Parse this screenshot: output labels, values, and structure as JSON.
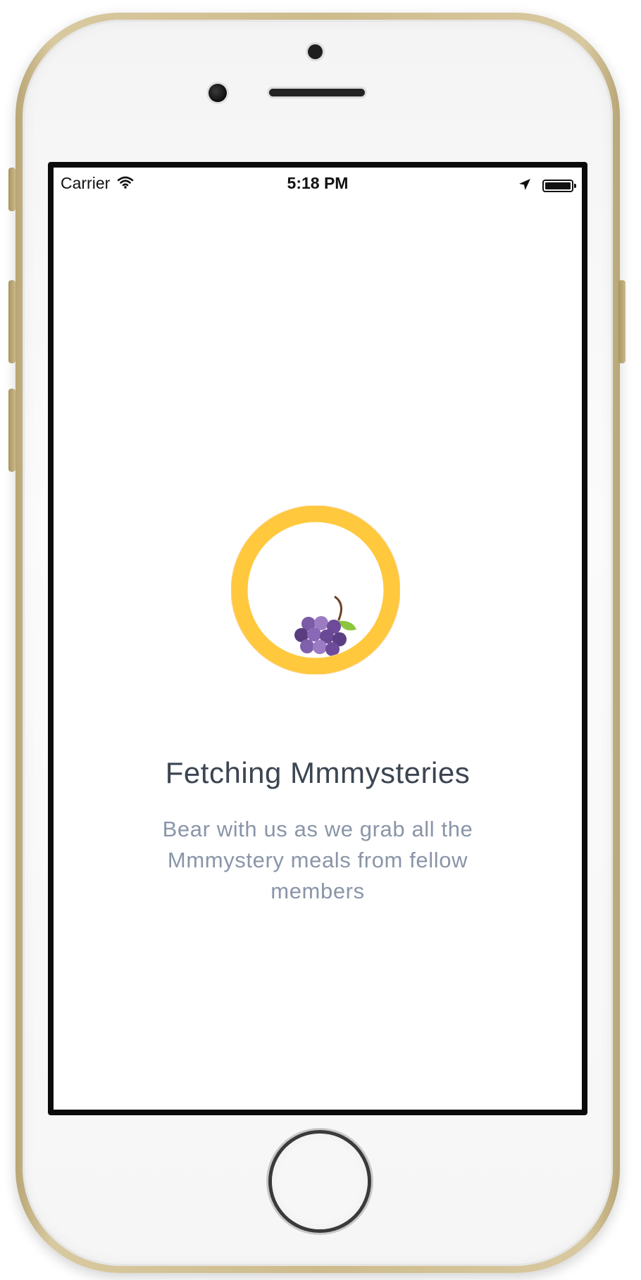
{
  "status_bar": {
    "carrier": "Carrier",
    "time": "5:18 PM",
    "battery_level": 1.0
  },
  "loading": {
    "title": "Fetching Mmmysteries",
    "message": "Bear with us as we grab all the Mmmystery meals from fellow members",
    "ring_color": "#ffc83d",
    "grape_color": "#7b5aa6",
    "leaf_color": "#8cc63f"
  },
  "icons": {
    "wifi": "wifi-icon",
    "location": "location-arrow-icon",
    "battery": "battery-icon",
    "loader": "grapes-icon"
  }
}
